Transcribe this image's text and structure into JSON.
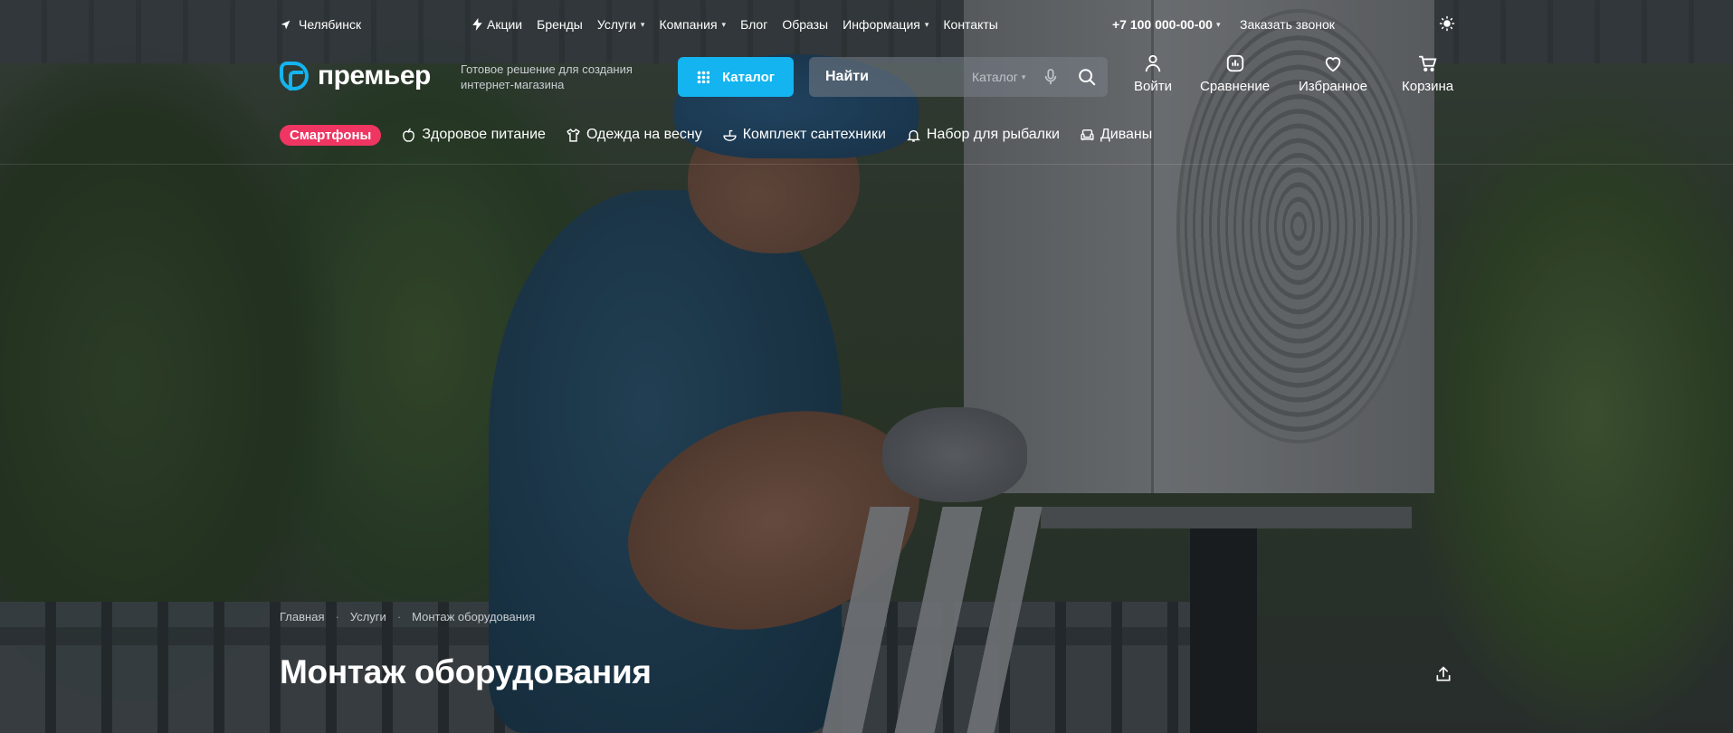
{
  "topbar": {
    "city": "Челябинск",
    "nav": [
      {
        "label": "Акции",
        "icon": "bolt-icon"
      },
      {
        "label": "Бренды"
      },
      {
        "label": "Услуги",
        "dropdown": true
      },
      {
        "label": "Компания",
        "dropdown": true
      },
      {
        "label": "Блог"
      },
      {
        "label": "Образы"
      },
      {
        "label": "Информация",
        "dropdown": true
      },
      {
        "label": "Контакты"
      }
    ],
    "phone": "+7 100 000-00-00",
    "callback": "Заказать звонок",
    "theme_icon": "sun-icon"
  },
  "header": {
    "logo_text": "премьер",
    "tagline": "Готовое решение для создания интернет-магазина",
    "catalog_label": "Каталог",
    "search": {
      "placeholder": "Найти",
      "scope": "Каталог"
    },
    "actions": {
      "login": "Войти",
      "compare": "Сравнение",
      "favorites": "Избранное",
      "cart": "Корзина"
    }
  },
  "quicklinks": [
    {
      "label": "Смартфоны",
      "highlight": true
    },
    {
      "label": "Здоровое питание",
      "icon": "apple-icon"
    },
    {
      "label": "Одежда на весну",
      "icon": "tshirt-icon"
    },
    {
      "label": "Комплект сантехники",
      "icon": "sink-icon"
    },
    {
      "label": "Набор для рыбалки",
      "icon": "bell-icon"
    },
    {
      "label": "Диваны",
      "icon": "sofa-icon"
    }
  ],
  "breadcrumb": [
    "Главная",
    "Услуги",
    "Монтаж оборудования"
  ],
  "page_title": "Монтаж оборудования",
  "colors": {
    "accent": "#13b4f0",
    "hot": "#ef3562"
  }
}
